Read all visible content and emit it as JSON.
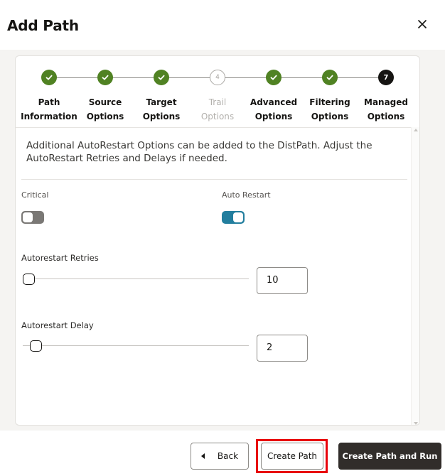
{
  "dialog": {
    "title": "Add Path",
    "close_icon": "close-icon"
  },
  "train": {
    "steps": [
      {
        "line1": "Path",
        "line2": "Information",
        "state": "done"
      },
      {
        "line1": "Source",
        "line2": "Options",
        "state": "done"
      },
      {
        "line1": "Target",
        "line2": "Options",
        "state": "done"
      },
      {
        "line1": "Trail",
        "line2": "Options",
        "state": "disabled",
        "number": "4"
      },
      {
        "line1": "Advanced",
        "line2": "Options",
        "state": "done"
      },
      {
        "line1": "Filtering",
        "line2": "Options",
        "state": "done"
      },
      {
        "line1": "Managed",
        "line2": "Options",
        "state": "current",
        "number": "7"
      }
    ]
  },
  "content": {
    "description": "Additional AutoRestart Options can be added to the DistPath. Adjust the AutoRestart Retries and Delays if needed.",
    "critical": {
      "label": "Critical",
      "on": false
    },
    "auto_restart": {
      "label": "Auto Restart",
      "on": true
    },
    "retries": {
      "label": "Autorestart Retries",
      "value": "10",
      "slider_fraction": 0
    },
    "delay": {
      "label": "Autorestart Delay",
      "value": "2",
      "slider_fraction": 0.02
    }
  },
  "footer": {
    "back_label": "Back",
    "create_label": "Create Path",
    "create_run_label": "Create Path and Run"
  },
  "colors": {
    "step_done": "#508223",
    "switch_on": "#227e9e",
    "highlight": "#e8000b",
    "primary_button": "#312d2a"
  }
}
